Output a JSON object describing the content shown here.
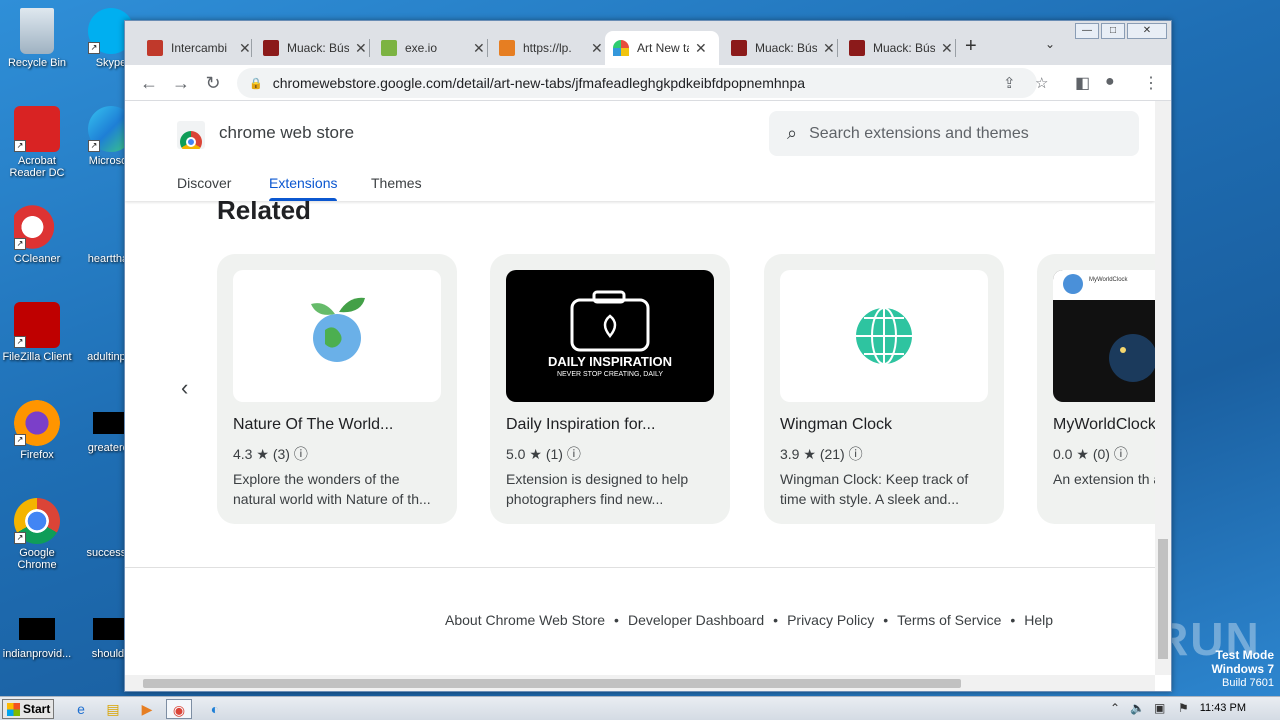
{
  "desktop": {
    "icons": [
      {
        "label": "Recycle Bin"
      },
      {
        "label": "Skype"
      },
      {
        "label": "Acrobat Reader DC"
      },
      {
        "label": "Microsoft"
      },
      {
        "label": "CCleaner"
      },
      {
        "label": "heartthan"
      },
      {
        "label": "FileZilla Client"
      },
      {
        "label": "adultinput"
      },
      {
        "label": "Firefox"
      },
      {
        "label": "greatercd"
      },
      {
        "label": "Google Chrome"
      },
      {
        "label": "successfu"
      },
      {
        "label": "indianprovid..."
      },
      {
        "label": "shoulda"
      }
    ],
    "watermark": "ANY RUN",
    "testmode": {
      "line1": "Test Mode",
      "line2": "Windows 7",
      "line3": "Build 7601"
    }
  },
  "browser": {
    "tabs": [
      {
        "label": "Intercambi",
        "color": "#c0392b"
      },
      {
        "label": "Muack: Bús",
        "color": "#8b1a1a"
      },
      {
        "label": "exe.io",
        "color": "#7cb342"
      },
      {
        "label": "https://lp.",
        "color": "#e67e22"
      },
      {
        "label": "Art New ta",
        "color": "#e74c3c"
      },
      {
        "label": "Muack: Bús",
        "color": "#8b1a1a"
      },
      {
        "label": "Muack: Bús",
        "color": "#8b1a1a"
      }
    ],
    "url": "chromewebstore.google.com/detail/art-new-tabs/jfmafeadleghgkpdkeibfdpopnemhnpa"
  },
  "store": {
    "title": "chrome web store",
    "search_placeholder": "Search extensions and themes",
    "nav": [
      "Discover",
      "Extensions",
      "Themes"
    ],
    "section_title": "Related",
    "cards": [
      {
        "name": "Nature Of The World...",
        "rating": "4.3",
        "count": "(3)",
        "desc": "Explore the wonders of the natural world with Nature of th..."
      },
      {
        "name": "Daily Inspiration for...",
        "rating": "5.0",
        "count": "(1)",
        "desc": "Extension is designed to help photographers find new...",
        "thumb_title": "DAILY INSPIRATION",
        "thumb_sub": "NEVER STOP CREATING, DAILY"
      },
      {
        "name": "Wingman Clock",
        "rating": "3.9",
        "count": "(21)",
        "desc": "Wingman Clock: Keep track of time with style. A sleek and..."
      },
      {
        "name": "MyWorldClock",
        "rating": "0.0",
        "count": "(0)",
        "desc": "An extension th any time zone o",
        "thumb_title": "MyWorldClock"
      }
    ],
    "footer": [
      "About Chrome Web Store",
      "Developer Dashboard",
      "Privacy Policy",
      "Terms of Service",
      "Help"
    ]
  },
  "taskbar": {
    "start": "Start",
    "clock": "11:43 PM"
  }
}
